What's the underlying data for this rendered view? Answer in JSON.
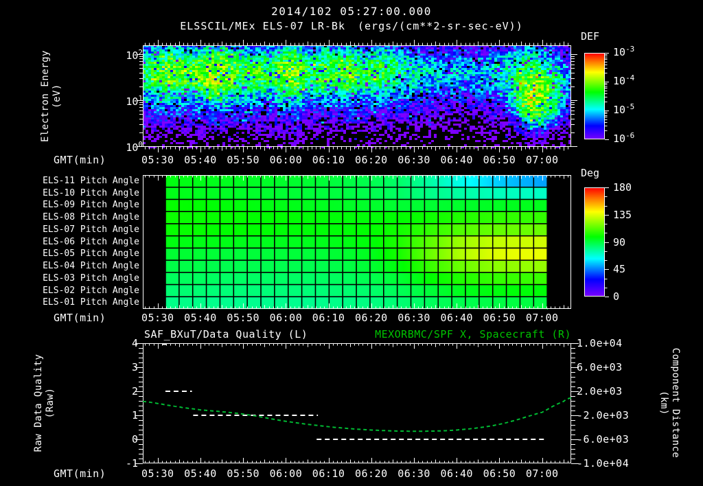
{
  "header": {
    "datetime": "2014/102 05:27:00.000",
    "instrument": "ELSSCIL/MEx ELS-07 LR-Bk",
    "units": "(ergs/(cm**2-sr-sec-eV))"
  },
  "colors": {
    "background": "#000000",
    "foreground": "#ffffff",
    "green_text": "#00c400",
    "green_line": "#00bb33",
    "rainbow_stops": [
      [
        0.0,
        [
          125,
          0,
          255
        ]
      ],
      [
        0.16,
        [
          0,
          0,
          255
        ]
      ],
      [
        0.35,
        [
          0,
          255,
          255
        ]
      ],
      [
        0.55,
        [
          0,
          255,
          0
        ]
      ],
      [
        0.78,
        [
          255,
          255,
          0
        ]
      ],
      [
        0.9,
        [
          255,
          120,
          0
        ]
      ],
      [
        1.0,
        [
          255,
          0,
          0
        ]
      ]
    ]
  },
  "time_axis": {
    "label": "GMT(min)",
    "tick_labels": [
      "05:30",
      "05:40",
      "05:50",
      "06:00",
      "06:10",
      "06:20",
      "06:30",
      "06:40",
      "06:50",
      "07:00"
    ],
    "first_tick_offset_min": 3,
    "minutes_per_tick": 10,
    "axis_start_min": -0.5,
    "axis_span_min": 100.3
  },
  "chart_data": [
    {
      "type": "heatmap",
      "id": "electron-energy-spectrogram",
      "ylabel_lines": [
        "Electron Energy",
        "(eV)"
      ],
      "ytick_labels": [
        "10^2",
        "10^1",
        "10^0"
      ],
      "log_energy_top": 2.19,
      "colorbar": {
        "label": "DEF",
        "tick_labels": [
          "10^-3",
          "10^-4",
          "10^-5",
          "10^-6"
        ],
        "log_min": -6,
        "log_max": -3
      },
      "black_threshold": -6.3,
      "noise_amplitude": 1.0,
      "grid_log10_def": [
        [
          -5.5,
          -5.4,
          -5.1,
          -5.4,
          -5.4,
          -5.0,
          -5.1,
          -5.4,
          -5.4,
          -5.5,
          -5.3,
          -5.0,
          -5.5,
          -5.4,
          -5.5,
          -5.2,
          -5.5,
          -5.5,
          -5.6,
          -5.7,
          -5.8,
          -5.9,
          -5.9,
          -5.8,
          -5.9,
          -5.8,
          -5.8,
          -5.5,
          -5.3,
          -5.5,
          -5.8,
          -6.0
        ],
        [
          -5.0,
          -4.9,
          -4.6,
          -4.8,
          -4.8,
          -4.4,
          -4.5,
          -4.9,
          -4.8,
          -4.9,
          -4.7,
          -4.4,
          -5.0,
          -4.8,
          -4.9,
          -4.7,
          -5.0,
          -4.9,
          -5.0,
          -5.2,
          -5.4,
          -5.5,
          -5.6,
          -5.5,
          -5.6,
          -5.5,
          -5.4,
          -5.0,
          -4.9,
          -5.1,
          -5.5,
          -5.8
        ],
        [
          -4.7,
          -4.5,
          -4.2,
          -4.4,
          -4.3,
          -4.0,
          -4.1,
          -4.5,
          -4.4,
          -4.5,
          -4.3,
          -4.1,
          -4.6,
          -4.4,
          -4.5,
          -4.3,
          -4.6,
          -4.5,
          -4.6,
          -4.8,
          -5.0,
          -5.1,
          -5.2,
          -5.1,
          -5.2,
          -5.1,
          -5.0,
          -4.7,
          -4.6,
          -4.8,
          -5.1,
          -5.6
        ],
        [
          -4.6,
          -4.4,
          -4.1,
          -4.3,
          -4.2,
          -3.9,
          -4.0,
          -4.4,
          -4.3,
          -4.4,
          -4.2,
          -4.0,
          -4.5,
          -4.3,
          -4.4,
          -4.2,
          -4.5,
          -4.4,
          -4.5,
          -4.7,
          -4.9,
          -5.0,
          -5.1,
          -5.0,
          -5.1,
          -5.0,
          -4.9,
          -4.5,
          -4.2,
          -4.3,
          -4.8,
          -5.5
        ],
        [
          -4.7,
          -4.5,
          -4.2,
          -4.4,
          -4.3,
          -4.0,
          -4.1,
          -4.5,
          -4.4,
          -4.5,
          -4.3,
          -4.1,
          -4.6,
          -4.4,
          -4.5,
          -4.3,
          -4.6,
          -4.5,
          -4.6,
          -4.8,
          -5.0,
          -5.1,
          -5.2,
          -5.1,
          -5.2,
          -5.1,
          -5.0,
          -4.4,
          -4.0,
          -4.1,
          -4.7,
          -5.5
        ],
        [
          -5.0,
          -4.9,
          -4.6,
          -4.8,
          -4.7,
          -4.4,
          -4.5,
          -4.9,
          -4.8,
          -4.9,
          -4.7,
          -4.5,
          -5.0,
          -4.8,
          -4.9,
          -4.7,
          -5.0,
          -4.9,
          -5.0,
          -5.2,
          -5.3,
          -5.4,
          -5.5,
          -5.4,
          -5.5,
          -5.4,
          -5.3,
          -4.5,
          -3.9,
          -4.0,
          -4.6,
          -5.6
        ],
        [
          -5.3,
          -5.2,
          -5.0,
          -5.2,
          -5.1,
          -4.9,
          -5.0,
          -5.2,
          -5.2,
          -5.3,
          -5.1,
          -4.9,
          -5.4,
          -5.2,
          -5.3,
          -5.1,
          -5.4,
          -5.3,
          -5.4,
          -5.5,
          -5.7,
          -5.7,
          -5.8,
          -5.7,
          -5.8,
          -5.7,
          -5.6,
          -4.7,
          -3.9,
          -4.0,
          -4.7,
          -5.8
        ],
        [
          -5.6,
          -5.5,
          -5.3,
          -5.5,
          -5.4,
          -5.2,
          -5.3,
          -5.5,
          -5.5,
          -5.6,
          -5.4,
          -5.3,
          -5.7,
          -5.5,
          -5.6,
          -5.4,
          -5.7,
          -5.6,
          -5.7,
          -5.8,
          -5.9,
          -6.0,
          -6.0,
          -6.0,
          -6.0,
          -6.0,
          -5.9,
          -5.0,
          -4.1,
          -4.2,
          -4.9,
          -6.0
        ],
        [
          -5.9,
          -5.8,
          -5.7,
          -5.8,
          -5.8,
          -5.6,
          -5.7,
          -5.8,
          -5.8,
          -5.9,
          -5.8,
          -5.6,
          -6.0,
          -5.9,
          -5.9,
          -5.8,
          -6.0,
          -5.9,
          -6.0,
          -6.0,
          -6.1,
          -6.1,
          -6.2,
          -6.1,
          -6.2,
          -6.1,
          -6.1,
          -5.4,
          -4.5,
          -4.6,
          -5.3,
          -6.2
        ],
        [
          -6.2,
          -6.1,
          -6.1,
          -6.1,
          -6.1,
          -6.0,
          -6.1,
          -6.1,
          -6.1,
          -6.2,
          -6.1,
          -6.0,
          -6.2,
          -6.2,
          -6.2,
          -6.1,
          -6.2,
          -6.2,
          -6.2,
          -6.3,
          -6.3,
          -6.3,
          -6.4,
          -6.3,
          -6.4,
          -6.3,
          -6.3,
          -5.9,
          -5.3,
          -5.4,
          -5.9,
          -6.4
        ],
        [
          -6.4,
          -6.4,
          -6.4,
          -6.4,
          -6.4,
          -6.3,
          -6.4,
          -6.4,
          -6.4,
          -6.4,
          -6.4,
          -6.3,
          -6.5,
          -6.4,
          -6.5,
          -6.4,
          -6.5,
          -6.5,
          -6.5,
          -6.5,
          -6.5,
          -6.5,
          -6.6,
          -6.5,
          -6.6,
          -6.5,
          -6.5,
          -6.3,
          -6.0,
          -6.1,
          -6.4,
          -6.6
        ],
        [
          -6.6,
          -6.6,
          -6.6,
          -6.6,
          -6.6,
          -6.5,
          -6.6,
          -6.6,
          -6.6,
          -6.6,
          -6.6,
          -6.5,
          -6.7,
          -6.6,
          -6.7,
          -6.6,
          -6.7,
          -6.7,
          -6.7,
          -6.7,
          -6.7,
          -6.7,
          -6.7,
          -6.7,
          -6.7,
          -6.7,
          -6.7,
          -6.5,
          -6.3,
          -6.3,
          -6.6,
          -6.7
        ]
      ]
    },
    {
      "type": "heatmap",
      "id": "pitch-angle-panel",
      "row_labels": [
        "ELS-11 Pitch Angle",
        "ELS-10 Pitch Angle",
        "ELS-09 Pitch Angle",
        "ELS-08 Pitch Angle",
        "ELS-07 Pitch Angle",
        "ELS-06 Pitch Angle",
        "ELS-05 Pitch Angle",
        "ELS-04 Pitch Angle",
        "ELS-03 Pitch Angle",
        "ELS-02 Pitch Angle",
        "ELS-01 Pitch Angle"
      ],
      "colorbar": {
        "label": "Deg",
        "tick_labels": [
          "180",
          "135",
          "90",
          "45",
          "0"
        ],
        "min": 0,
        "max": 180
      },
      "data_start_min": 4.8,
      "data_end_min": 94.2,
      "n_grid_cols": 28,
      "values_deg": [
        [
          97,
          96,
          95,
          94,
          93,
          92,
          90,
          88,
          84,
          76,
          66,
          58,
          53,
          50
        ],
        [
          96,
          95,
          94,
          93,
          92,
          91,
          90,
          88,
          85,
          80,
          76,
          73,
          72,
          71
        ],
        [
          100,
          99,
          98,
          97,
          96,
          95,
          94,
          93,
          92,
          92,
          93,
          94,
          95,
          95
        ],
        [
          101,
          100,
          100,
          99,
          99,
          98,
          98,
          98,
          99,
          101,
          104,
          106,
          107,
          107
        ],
        [
          100,
          100,
          99,
          99,
          98,
          98,
          98,
          99,
          102,
          107,
          112,
          115,
          116,
          116
        ],
        [
          97,
          96,
          96,
          95,
          95,
          95,
          96,
          98,
          104,
          114,
          124,
          130,
          132,
          133
        ],
        [
          92,
          92,
          91,
          91,
          91,
          91,
          92,
          95,
          103,
          116,
          127,
          134,
          137,
          137
        ],
        [
          89,
          89,
          88,
          88,
          88,
          88,
          89,
          92,
          98,
          108,
          116,
          121,
          123,
          123
        ],
        [
          86,
          86,
          85,
          85,
          85,
          85,
          86,
          88,
          92,
          99,
          104,
          107,
          108,
          108
        ],
        [
          83,
          83,
          82,
          82,
          82,
          82,
          83,
          84,
          87,
          91,
          95,
          97,
          98,
          98
        ],
        [
          80,
          80,
          79,
          79,
          79,
          79,
          80,
          81,
          83,
          86,
          88,
          89,
          90,
          90
        ]
      ]
    },
    {
      "type": "line",
      "id": "quality-distance-plot",
      "title_left": "SAF_BXuT/Data Quality (L)",
      "title_right": "MEXORBMC/SPF X, Spacecraft (R)",
      "ylabel_left_lines": [
        "Raw Data Quality",
        "(Raw)"
      ],
      "ylabel_right_lines": [
        "Component Distance",
        "(km)"
      ],
      "ytick_labels_left": [
        "4",
        "3",
        "2",
        "1",
        "0",
        "-1"
      ],
      "ylim_left": [
        -1,
        4
      ],
      "ytick_labels_right": [
        "1.0e+04",
        "6.0e+03",
        "2.0e+03",
        "-2.0e+03",
        "-6.0e+03",
        "-1.0e+04"
      ],
      "ylim_right": [
        -10000,
        10000
      ],
      "series": [
        {
          "name": "raw-data-quality",
          "color": "#ffffff",
          "style": "dashed-steps",
          "segments": [
            {
              "value": 4,
              "t_start": 4.0,
              "t_end": 5.6
            },
            {
              "value": 2,
              "t_start": 4.8,
              "t_end": 11.0
            },
            {
              "value": 1,
              "t_start": 11.3,
              "t_end": 40.5
            },
            {
              "value": 0,
              "t_start": 40.2,
              "t_end": 94.0
            }
          ]
        },
        {
          "name": "spacecraft-x-distance",
          "color": "#00bb33",
          "style": "dashed-curve",
          "t_min": [
            -0.5,
            8,
            13,
            23,
            33,
            43,
            53,
            63,
            73,
            83,
            93,
            98,
            99.8
          ],
          "km": [
            300,
            -600,
            -1100,
            -1800,
            -3000,
            -3900,
            -4450,
            -4650,
            -4450,
            -3500,
            -1500,
            300,
            900
          ]
        }
      ]
    }
  ]
}
